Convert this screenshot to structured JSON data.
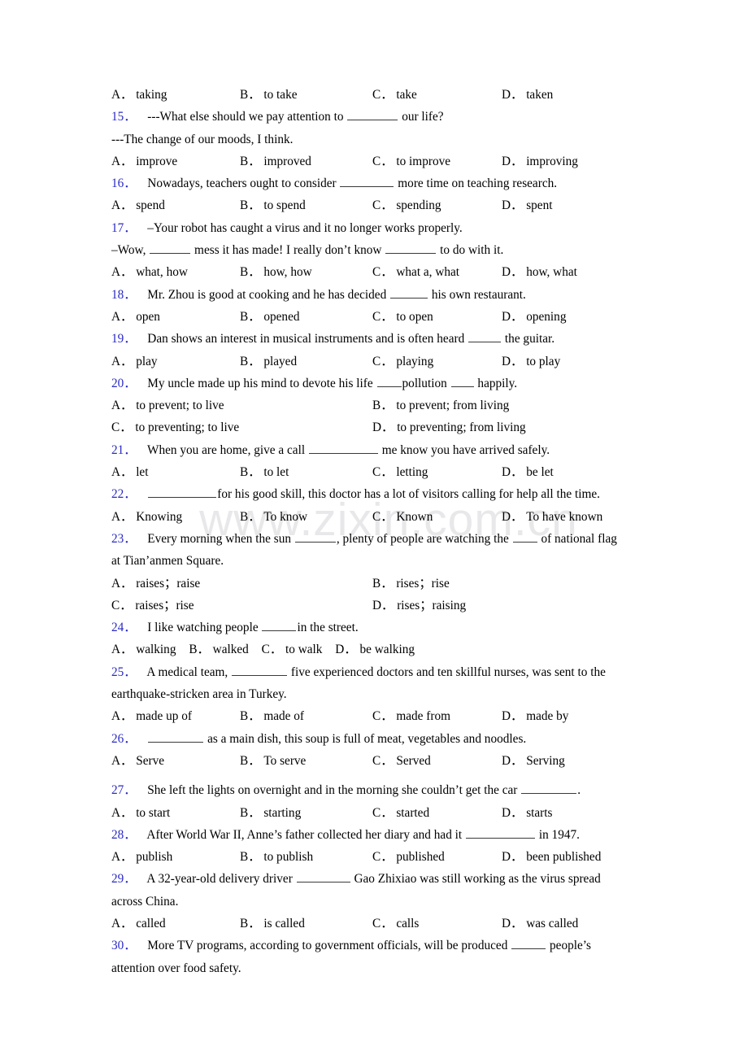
{
  "document": {
    "type": "grammar-exercise-worksheet",
    "watermark": "www.zixin.com.cn",
    "number_color": "#2a2ac4",
    "text_color": "#000000",
    "background": "#ffffff"
  },
  "top_options": {
    "a_label": "A．",
    "a_value": "taking",
    "b_label": "B．",
    "b_value": "to take",
    "c_label": "C．",
    "c_value": "take",
    "d_label": "D．",
    "d_value": "taken"
  },
  "questions": [
    {
      "num": "15．",
      "stem_before": "---What else should we pay attention to",
      "stem_after": "our life?",
      "blank_width": 62,
      "extra_line": "---The change of our moods, I think.",
      "layout": "four-col",
      "options": [
        {
          "label": "A．",
          "value": "improve"
        },
        {
          "label": "B．",
          "value": "improved"
        },
        {
          "label": "C．",
          "value": "to improve"
        },
        {
          "label": "D．",
          "value": "improving"
        }
      ]
    },
    {
      "num": "16．",
      "stem_before": "Nowadays, teachers ought to consider",
      "stem_after": "more time on teaching research.",
      "blank_width": 66,
      "layout": "four-col",
      "options": [
        {
          "label": "A．",
          "value": "spend"
        },
        {
          "label": "B．",
          "value": "to spend"
        },
        {
          "label": "C．",
          "value": "spending"
        },
        {
          "label": "D．",
          "value": "spent"
        }
      ]
    },
    {
      "num": "17．",
      "stem_before": "–Your robot has caught a virus and it no longer works properly.",
      "stem_after": "",
      "blank_width": 0,
      "dialog_line": {
        "before": "–Wow,",
        "blank1_width": 50,
        "middle": "mess it has made! I really don’t know",
        "blank2_width": 62,
        "after": "to do with it."
      },
      "layout": "four-col",
      "options": [
        {
          "label": "A．",
          "value": "what, how"
        },
        {
          "label": "B．",
          "value": "how, how"
        },
        {
          "label": "C．",
          "value": "what a, what"
        },
        {
          "label": "D．",
          "value": "how, what"
        }
      ]
    },
    {
      "num": "18．",
      "stem_before": "Mr. Zhou is good at cooking and he has decided",
      "stem_after": "his own restaurant.",
      "blank_width": 46,
      "layout": "four-col",
      "options": [
        {
          "label": "A．",
          "value": "open"
        },
        {
          "label": "B．",
          "value": "opened"
        },
        {
          "label": "C．",
          "value": "to open"
        },
        {
          "label": "D．",
          "value": "opening"
        }
      ]
    },
    {
      "num": "19．",
      "stem_before": "Dan shows an interest in musical instruments and is often heard",
      "stem_after": "the guitar.",
      "blank_width": 40,
      "layout": "four-col",
      "options": [
        {
          "label": "A．",
          "value": "play"
        },
        {
          "label": "B．",
          "value": "played"
        },
        {
          "label": "C．",
          "value": "playing"
        },
        {
          "label": "D．",
          "value": "to play"
        }
      ]
    },
    {
      "num": "20．",
      "stem_before": "My uncle made up his mind to devote his life",
      "blank1_width": 30,
      "stem_middle": "pollution",
      "blank2_width": 28,
      "stem_after": "happily.",
      "layout": "two-col",
      "options": [
        {
          "label": "A．",
          "value": "to prevent; to live"
        },
        {
          "label": "B．",
          "value": "to prevent; from living"
        },
        {
          "label": "C．",
          "value": "to preventing; to live"
        },
        {
          "label": "D．",
          "value": "to preventing; from living"
        }
      ]
    },
    {
      "num": "21．",
      "stem_before": "When you are home, give a call",
      "stem_after": "me know you have arrived safely.",
      "blank_width": 85,
      "layout": "four-col",
      "options": [
        {
          "label": "A．",
          "value": "let"
        },
        {
          "label": "B．",
          "value": "to let"
        },
        {
          "label": "C．",
          "value": "letting"
        },
        {
          "label": "D．",
          "value": "be let"
        }
      ]
    },
    {
      "num": "22．",
      "stem_leading_blank_width": 84,
      "stem_before": "",
      "stem_after": "for his good skill, this doctor has a lot of visitors calling for help all the time.",
      "layout": "four-col",
      "options": [
        {
          "label": "A．",
          "value": "Knowing"
        },
        {
          "label": "B．",
          "value": "To know"
        },
        {
          "label": "C．",
          "value": "Known"
        },
        {
          "label": "D．",
          "value": "To have known"
        }
      ]
    },
    {
      "num": "23．",
      "stem_before": "Every morning when the sun",
      "blank1_width": 50,
      "stem_middle": ", plenty of people are watching the",
      "blank2_width": 30,
      "stem_after": "of national flag",
      "second_line": "at Tian’anmen Square.",
      "layout": "two-col",
      "options": [
        {
          "label": "A．",
          "value": "raises；raise"
        },
        {
          "label": "B．",
          "value": "rises；rise"
        },
        {
          "label": "C．",
          "value": "raises；rise"
        },
        {
          "label": "D．",
          "value": "rises；raising"
        }
      ]
    },
    {
      "num": "24．",
      "stem_before": "I like watching people",
      "stem_after": "in the street.",
      "blank_width": 42,
      "layout": "inline",
      "options": [
        {
          "label": "A．",
          "value": "walking"
        },
        {
          "label": "B．",
          "value": "walked"
        },
        {
          "label": "C．",
          "value": "to walk"
        },
        {
          "label": "D．",
          "value": "be walking"
        }
      ]
    },
    {
      "num": "25．",
      "stem_before": "A medical team,",
      "stem_after": "five experienced doctors and ten skillful nurses, was sent to the",
      "blank_width": 68,
      "second_line": "earthquake-stricken area in Turkey.",
      "layout": "four-col",
      "options": [
        {
          "label": "A．",
          "value": "made up of"
        },
        {
          "label": "B．",
          "value": "made of"
        },
        {
          "label": "C．",
          "value": "made from"
        },
        {
          "label": "D．",
          "value": "made by"
        }
      ]
    },
    {
      "num": "26．",
      "stem_leading_blank_width": 68,
      "stem_before": "",
      "stem_after": "as a main dish, this soup is full of meat, vegetables and noodles.",
      "layout": "four-col",
      "options": [
        {
          "label": "A．",
          "value": "Serve"
        },
        {
          "label": "B．",
          "value": "To serve"
        },
        {
          "label": "C．",
          "value": "Served"
        },
        {
          "label": "D．",
          "value": "Serving"
        }
      ]
    },
    {
      "num": "27．",
      "stem_before": "She left the lights on overnight and in the morning she couldn’t get the car",
      "stem_after": ".",
      "blank_width": 68,
      "layout": "four-col",
      "options": [
        {
          "label": "A．",
          "value": "to start"
        },
        {
          "label": "B．",
          "value": "starting"
        },
        {
          "label": "C．",
          "value": "started"
        },
        {
          "label": "D．",
          "value": "starts"
        }
      ]
    },
    {
      "num": "28．",
      "stem_before": "After World War II, Anne’s father collected her diary and had it",
      "stem_after": "in 1947.",
      "blank_width": 85,
      "layout": "four-col",
      "options": [
        {
          "label": "A．",
          "value": "publish"
        },
        {
          "label": "B．",
          "value": "to publish"
        },
        {
          "label": "C．",
          "value": "published"
        },
        {
          "label": "D．",
          "value": "been published"
        }
      ]
    },
    {
      "num": "29．",
      "stem_before": "A 32-year-old delivery driver",
      "stem_after": "Gao Zhixiao was still working as the virus spread",
      "blank_width": 66,
      "second_line": "across China.",
      "layout": "four-col",
      "options": [
        {
          "label": "A．",
          "value": "called"
        },
        {
          "label": "B．",
          "value": "is called"
        },
        {
          "label": "C．",
          "value": "calls"
        },
        {
          "label": "D．",
          "value": "was called"
        }
      ]
    },
    {
      "num": "30．",
      "stem_before": "More TV programs, according to government officials, will be produced",
      "stem_after": "people’s",
      "blank_width": 42,
      "second_line": "attention over food safety.",
      "layout": "none",
      "options": []
    }
  ]
}
